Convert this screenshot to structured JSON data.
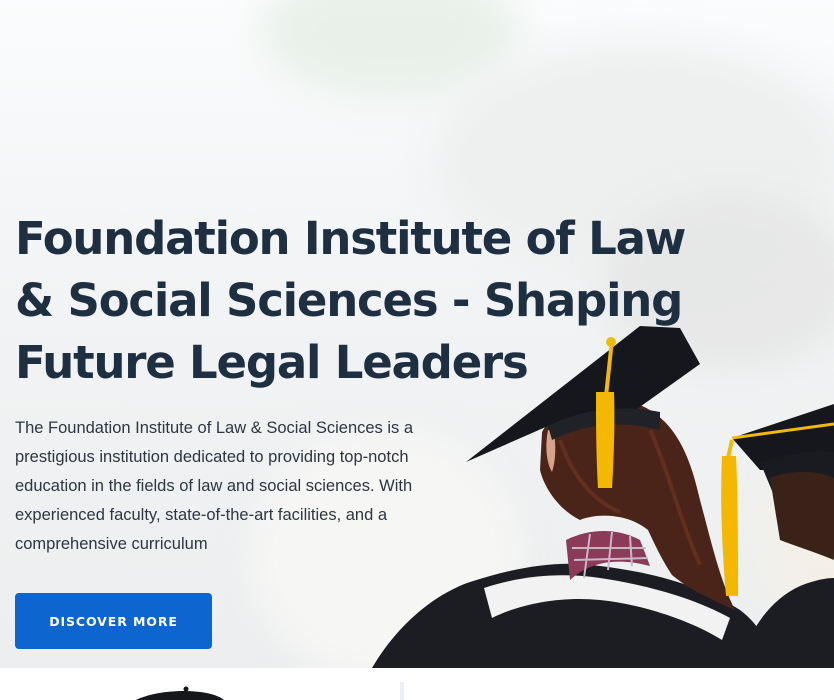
{
  "hero": {
    "title": "Foundation Institute of Law & Social Sciences - Shaping Future Legal Leaders",
    "description": "The Foundation Institute of Law & Social Sciences is a prestigious institution dedicated to providing top-notch education in the fields of law and social sciences. With experienced faculty, state-of-the-art facilities, and a comprehensive curriculum",
    "cta_label": "DISCOVER MORE"
  },
  "colors": {
    "heading": "#1e2f42",
    "body_text": "#2f3640",
    "button": "#0d66d0",
    "button_text": "#ffffff"
  }
}
